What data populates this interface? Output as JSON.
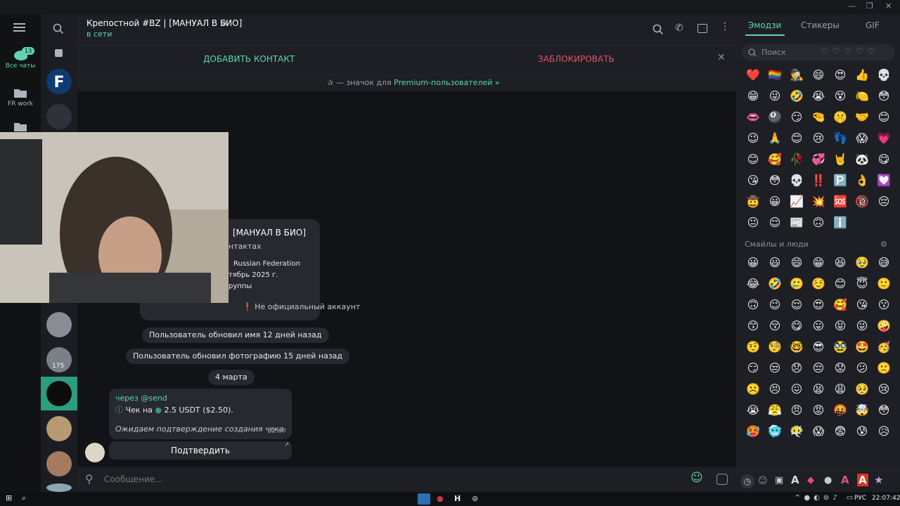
{
  "folders": [
    {
      "label": "Все чаты",
      "badge": "13"
    },
    {
      "label": "FR work"
    },
    {
      "label": ""
    }
  ],
  "chatlist": {
    "badge_175": "175"
  },
  "header": {
    "title": "Крепостной #BZ | [МАНУАЛ В БИО]",
    "status": "в сети"
  },
  "actionbar": {
    "add": "ДОБАВИТЬ КОНТАКТ",
    "block": "ЗАБЛОКИРОВАТЬ"
  },
  "premium": {
    "prefix": "— значок для ",
    "link": "Premium-пользователей »"
  },
  "profile_card": {
    "name_part": "[МАНУАЛ В БИО]",
    "contacts_part": "нтактах",
    "country": "Russian Federation",
    "date_part": "тябрь 2025 г.",
    "groups_part": "руппы",
    "official": "Не официальный аккаунт"
  },
  "service": [
    "Пользователь обновил имя 12 дней назад",
    "Пользователь обновил фотографию 15 дней назад"
  ],
  "date_pill": "4 марта",
  "message": {
    "via": "через @send",
    "line1": "Чек на",
    "amount": "2.5 USDT ($2.50).",
    "pending": "Ожидаем подтверждение создания чека.",
    "time": "22:07",
    "button": "Подтвердить"
  },
  "composer": {
    "placeholder": "Сообщение..."
  },
  "emoji_panel": {
    "tabs": [
      "Эмодзи",
      "Стикеры",
      "GIF"
    ],
    "search_placeholder": "Поиск",
    "section": "Смайлы и люди",
    "recent": [
      "❤️",
      "🏳️‍🌈",
      "🕵️",
      "😄",
      "😍",
      "👍",
      "💀",
      "😁",
      "😜",
      "🤣",
      "😭",
      "😵",
      "🍋",
      "😳",
      "👄",
      "🎱",
      "😏",
      "🤏",
      "🤫",
      "🤝",
      "😊",
      "😉",
      "🙏",
      "😊",
      "😢",
      "👣",
      "😱",
      "💗",
      "😊",
      "🥰",
      "🥀",
      "💞",
      "🤘",
      "🐼",
      "😋",
      "😘",
      "😳",
      "💀",
      "‼️",
      "🅿️",
      "👌",
      "💟",
      "🤠",
      "😀",
      "📈",
      "💥",
      "🆘",
      "🔞",
      "😔",
      "😐",
      "😌",
      "📰",
      "🙃",
      "ℹ️"
    ],
    "smileys": [
      "😀",
      "😃",
      "😄",
      "😁",
      "😆",
      "🥹",
      "😅",
      "😂",
      "🤣",
      "🥲",
      "☺️",
      "😊",
      "😇",
      "🙂",
      "🙃",
      "😉",
      "😌",
      "😍",
      "🥰",
      "😘",
      "😗",
      "😙",
      "😚",
      "😋",
      "😛",
      "😝",
      "😜",
      "🤪",
      "🤨",
      "🧐",
      "🤓",
      "😎",
      "🥸",
      "🤩",
      "🥳",
      "😏",
      "😒",
      "😞",
      "😔",
      "😟",
      "😕",
      "🙁",
      "☹️",
      "😣",
      "😖",
      "😫",
      "😩",
      "🥺",
      "😢",
      "😭",
      "😤",
      "😠",
      "😡",
      "🤬",
      "🤯",
      "😳",
      "🥵",
      "🥶",
      "😶‍🌫️",
      "😱",
      "😨",
      "😰",
      "😥",
      "😓",
      "🤗",
      "🤔",
      "🫣",
      "🤭"
    ]
  },
  "taskbar": {
    "lang": "РУС",
    "time": "22:07:42"
  },
  "colors": {
    "accent": "#5fd4b1",
    "danger": "#e5526e",
    "bg": "#111317",
    "panel": "#1d1f24"
  }
}
